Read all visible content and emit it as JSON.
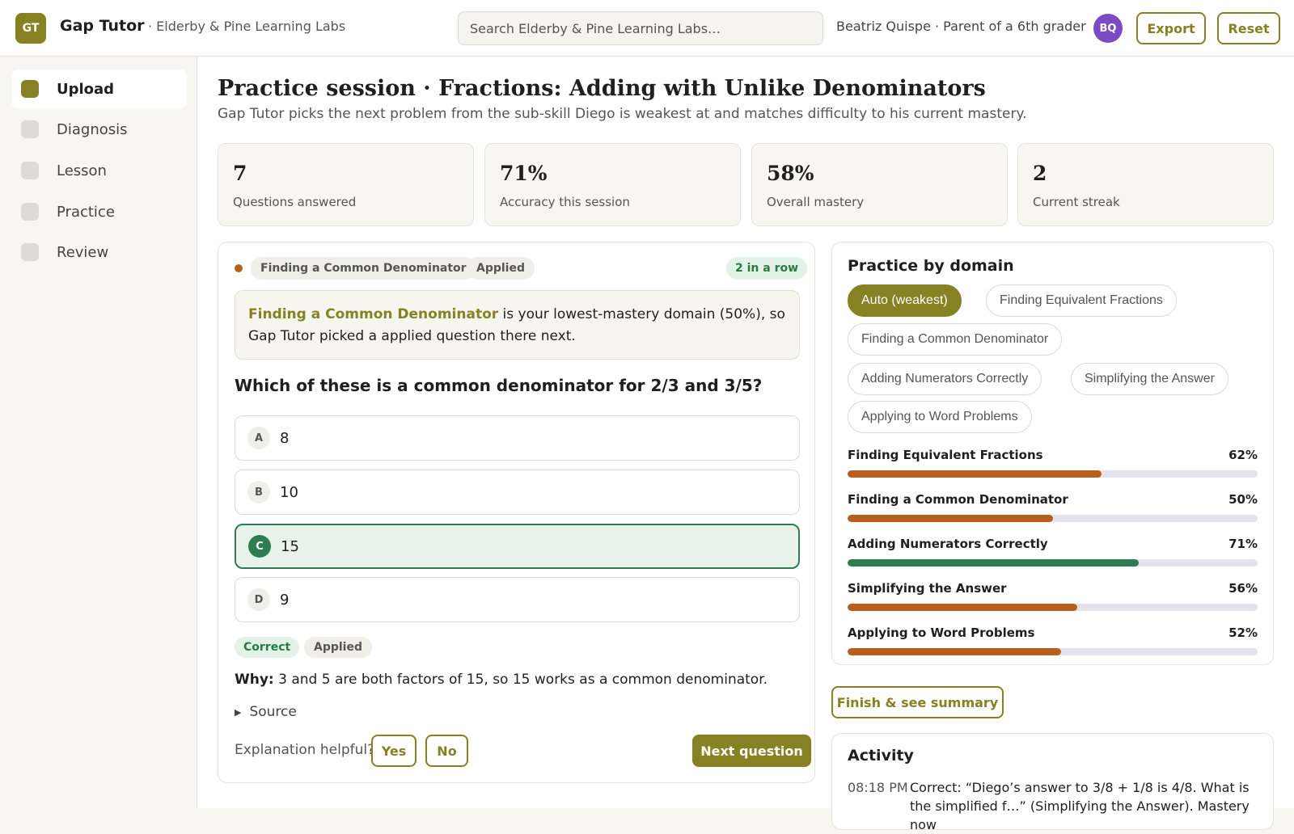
{
  "header": {
    "logo": "GT",
    "app_title": "Gap Tutor",
    "org_name": "· Elderby & Pine Learning Labs",
    "search_placeholder": "Search Elderby & Pine Learning Labs…",
    "user_label": "Beatriz Quispe · Parent of a 6th grader",
    "avatar_initials": "BQ",
    "export_label": "Export",
    "reset_label": "Reset"
  },
  "sidebar": {
    "items": [
      {
        "label": "Upload",
        "active": true
      },
      {
        "label": "Diagnosis",
        "active": false
      },
      {
        "label": "Lesson",
        "active": false
      },
      {
        "label": "Practice",
        "active": false
      },
      {
        "label": "Review",
        "active": false
      }
    ]
  },
  "page": {
    "title": "Practice session · Fractions: Adding with Unlike Denominators",
    "subtitle": "Gap Tutor picks the next problem from the sub-skill Diego is weakest at and matches difficulty to his current mastery."
  },
  "stats": [
    {
      "value": "7",
      "label": "Questions answered"
    },
    {
      "value": "71%",
      "label": "Accuracy this session"
    },
    {
      "value": "58%",
      "label": "Overall mastery"
    },
    {
      "value": "2",
      "label": "Current streak"
    }
  ],
  "question_card": {
    "domain_chip": "Finding a Common Denominator",
    "type_chip": "Applied",
    "streak_chip": "2 in a row",
    "note_highlight": "Finding a Common Denominator",
    "note_line1_rest": " is your lowest-mastery domain (50%), so",
    "note_line2": "Gap Tutor picked a applied question there next.",
    "question": "Which of these is a common denominator for 2/3 and 3/5?",
    "options": [
      {
        "letter": "A",
        "text": "8",
        "correct": false
      },
      {
        "letter": "B",
        "text": "10",
        "correct": false
      },
      {
        "letter": "C",
        "text": "15",
        "correct": true
      },
      {
        "letter": "D",
        "text": "9",
        "correct": false
      }
    ],
    "result_chip": "Correct",
    "result_type_chip": "Applied",
    "why_label": "Why:",
    "why_text": " 3 and 5 are both factors of 15, so 15 works as a common denominator.",
    "source_label": "Source",
    "helpful_label": "Explanation helpful?",
    "yes_label": "Yes",
    "no_label": "No",
    "next_label": "Next question"
  },
  "domain_panel": {
    "title": "Practice by domain",
    "filters": [
      {
        "label": "Auto (weakest)",
        "active": true
      },
      {
        "label": "Finding Equivalent Fractions",
        "active": false
      },
      {
        "label": "Finding a Common Denominator",
        "active": false
      },
      {
        "label": "Adding Numerators Correctly",
        "active": false
      },
      {
        "label": "Simplifying the Answer",
        "active": false
      },
      {
        "label": "Applying to Word Problems",
        "active": false
      }
    ],
    "domains": [
      {
        "name": "Finding Equivalent Fractions",
        "pct_label": "62%",
        "value": 62,
        "color": "#b85f1c"
      },
      {
        "name": "Finding a Common Denominator",
        "pct_label": "50%",
        "value": 50,
        "color": "#b85f1c"
      },
      {
        "name": "Adding Numerators Correctly",
        "pct_label": "71%",
        "value": 71,
        "color": "#2e7d52"
      },
      {
        "name": "Simplifying the Answer",
        "pct_label": "56%",
        "value": 56,
        "color": "#b85f1c"
      },
      {
        "name": "Applying to Word Problems",
        "pct_label": "52%",
        "value": 52,
        "color": "#b85f1c"
      }
    ]
  },
  "finish_label": "Finish & see summary",
  "activity": {
    "title": "Activity",
    "time": "08:18 PM",
    "text": "Correct: “Diego’s answer to 3/8 + 1/8 is 4/8. What is the simplified f…” (Simplifying the Answer). Mastery now"
  },
  "colors": {
    "accent": "#868122",
    "weak": "#b85f1c",
    "strong": "#2e7d52",
    "avatar": "#7b4bc6"
  }
}
